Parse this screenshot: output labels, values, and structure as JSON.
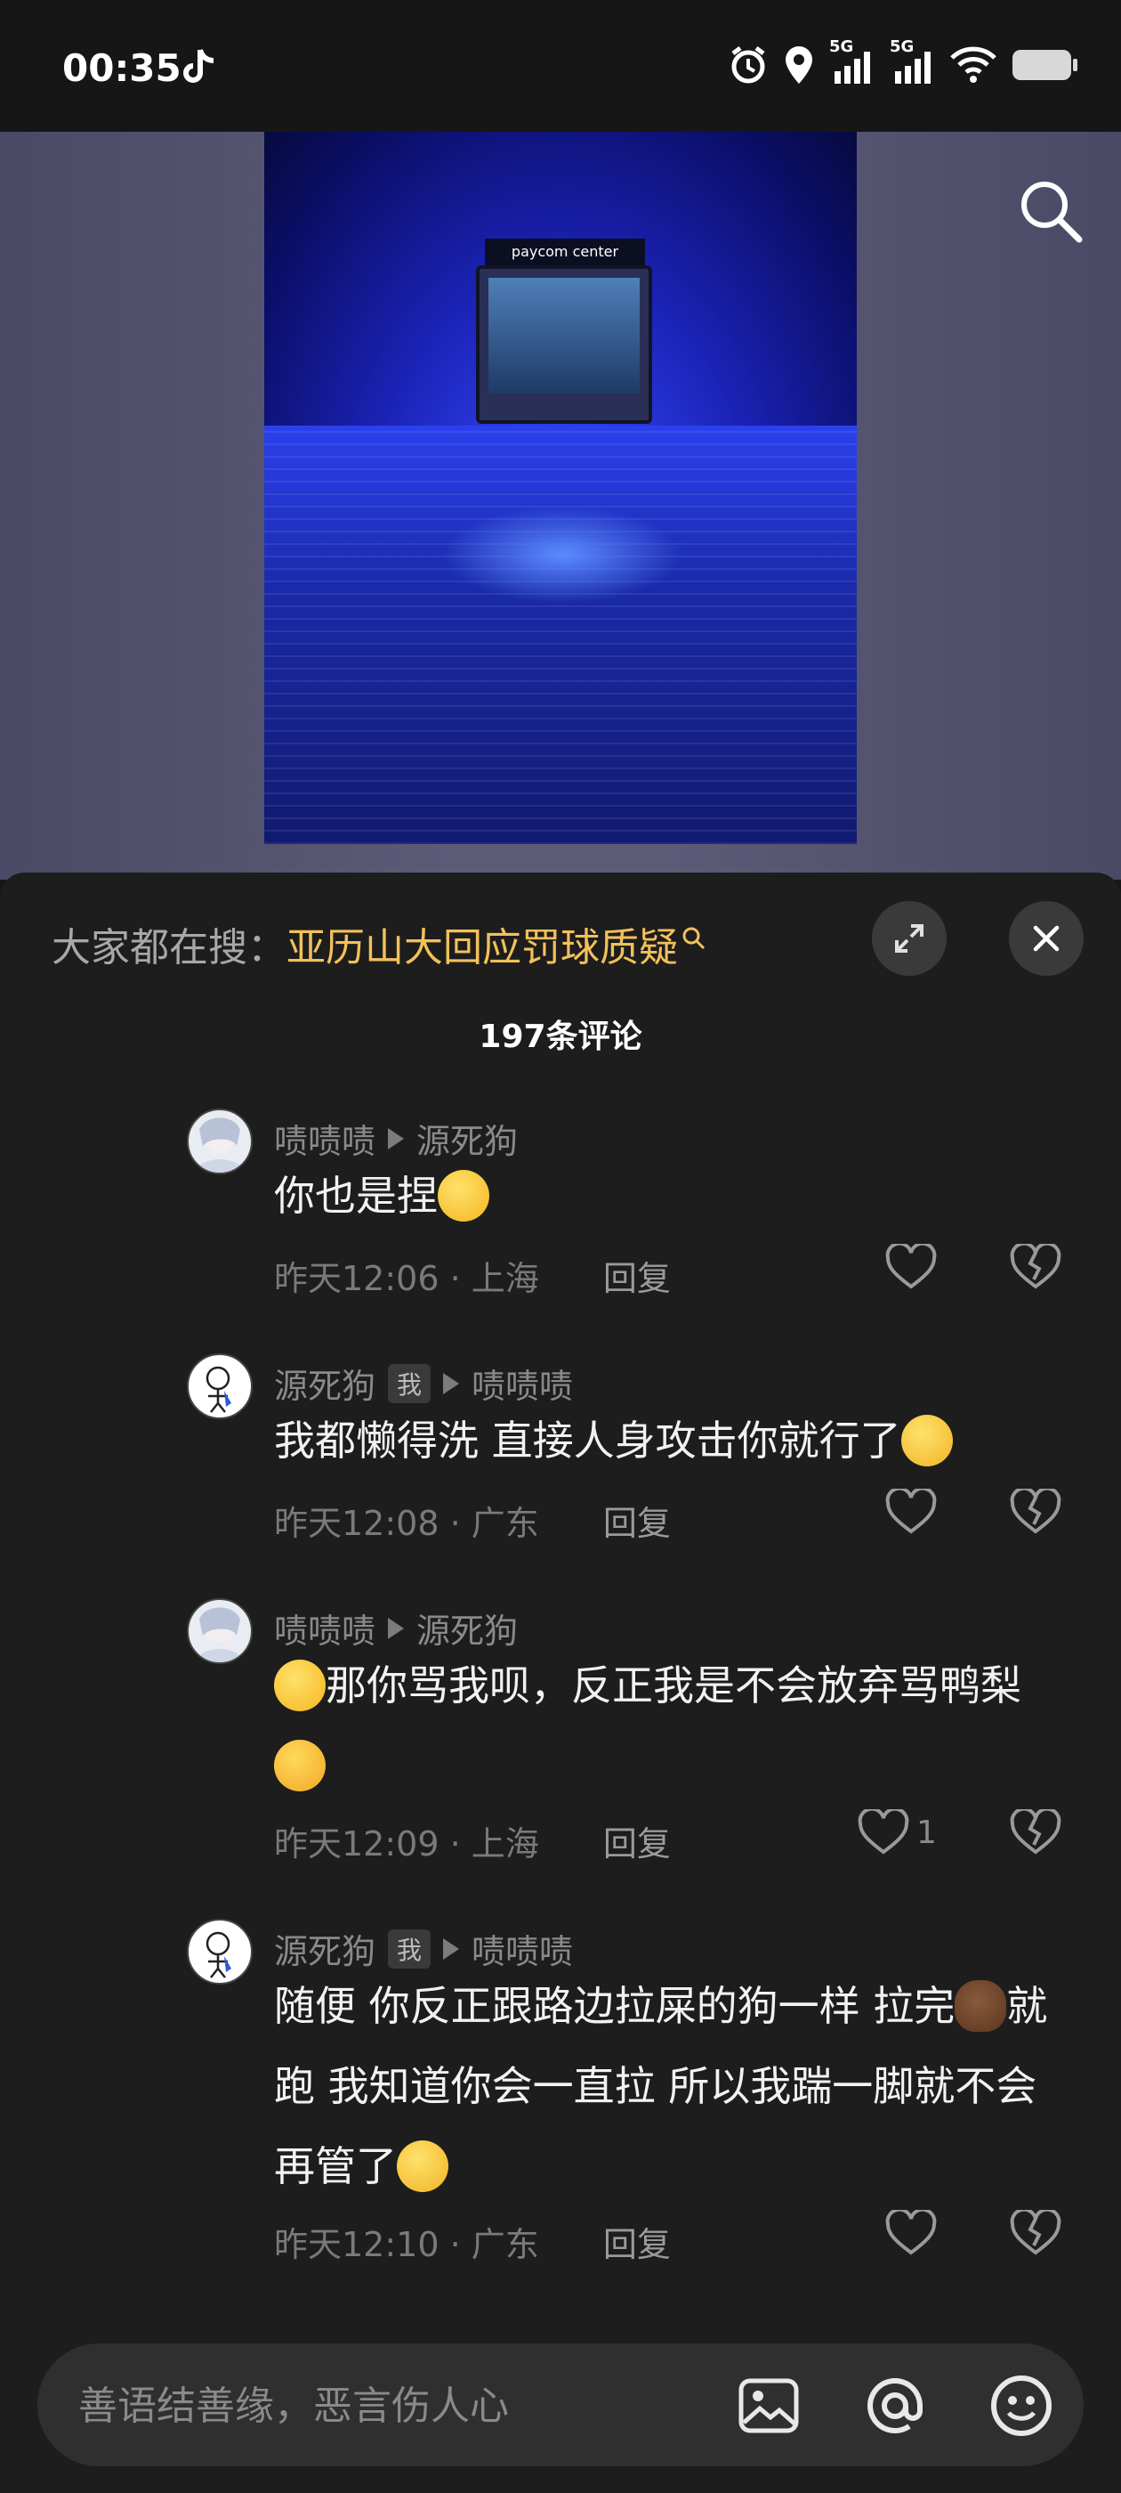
{
  "status_bar": {
    "time": "00:35",
    "network_label_1": "5G",
    "network_label_2": "5G"
  },
  "video": {
    "scoreboard_brand": "paycom center"
  },
  "comments_panel": {
    "hot_search_prefix": "大家都在搜：",
    "hot_search_keyword": "亚历山大回应罚球质疑",
    "comment_count": "197条评论"
  },
  "comments": [
    {
      "author": "啧啧啧",
      "reply_to": "源死狗",
      "is_me": false,
      "text": "你也是捏",
      "emoji_after": "laugh",
      "time": "昨天12:06",
      "location": "上海",
      "reply_label": "回复",
      "likes": ""
    },
    {
      "author": "源死狗",
      "me_tag": "我",
      "reply_to": "啧啧啧",
      "is_me": true,
      "text": "我都懒得洗 直接人身攻击你就行了",
      "emoji_after": "grin",
      "time": "昨天12:08",
      "location": "广东",
      "reply_label": "回复",
      "likes": ""
    },
    {
      "author": "啧啧啧",
      "reply_to": "源死狗",
      "is_me": false,
      "text": "那你骂我呗，反正我是不会放弃骂鸭梨",
      "emoji_before": "laugh",
      "emoji_after": "starstruck",
      "time": "昨天12:09",
      "location": "上海",
      "reply_label": "回复",
      "likes": "1"
    },
    {
      "author": "源死狗",
      "me_tag": "我",
      "reply_to": "啧啧啧",
      "is_me": true,
      "text_part1": "随便 你反正跟路边拉屎的狗一样 拉完",
      "text_part2": "就跑 我知道你会一直拉 所以我踹一脚就不会再管了",
      "emoji_mid": "poop",
      "emoji_after": "grin",
      "time": "昨天12:10",
      "location": "广东",
      "reply_label": "回复",
      "likes": ""
    }
  ],
  "input": {
    "placeholder": "善语结善缘，恶言伤人心"
  },
  "sep": "·"
}
